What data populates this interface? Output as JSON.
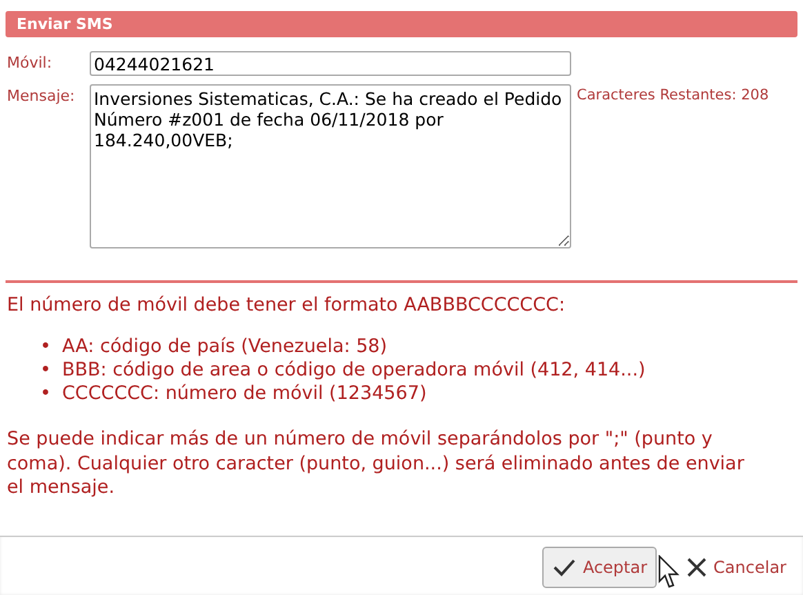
{
  "dialog": {
    "title": "Enviar SMS"
  },
  "form": {
    "phone": {
      "label": "Móvil:",
      "value": "04244021621"
    },
    "message": {
      "label": "Mensaje:",
      "value": "Inversiones Sistematicas, C.A.: Se ha creado el Pedido Número #z001 de fecha 06/11/2018 por 184.240,00VEB;"
    },
    "counter": "Caracteres Restantes: 208"
  },
  "help": {
    "intro": "El número de móvil debe tener el formato AABBBCCCCCCC:",
    "items": [
      {
        "marker": "•",
        "text": "AA: código de país (Venezuela: 58)"
      },
      {
        "marker": "•",
        "text": "BBB: código de area o código de operadora móvil (412, 414...)"
      },
      {
        "marker": "•",
        "text": "CCCCCCC: número de móvil (1234567)"
      }
    ],
    "note": "Se puede indicar más de un número de móvil separándolos por \";\" (punto y coma). Cualquier otro caracter (punto, guion...) será eliminado antes de enviar el mensaje."
  },
  "buttons": [
    {
      "kind": "accept",
      "label": "Aceptar"
    },
    {
      "kind": "cancel",
      "label": "Cancelar"
    }
  ]
}
